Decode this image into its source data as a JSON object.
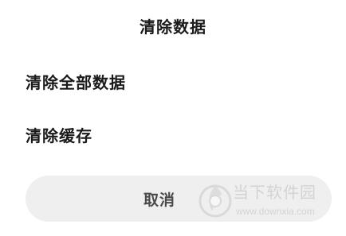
{
  "dialog": {
    "title": "清除数据",
    "options": [
      {
        "label": "清除全部数据"
      },
      {
        "label": "清除缓存"
      }
    ],
    "cancel_label": "取消"
  },
  "watermark": {
    "brand": "当下软件园",
    "url": "www.downxia.com",
    "icon": "downxia-logo-icon"
  },
  "colors": {
    "background": "#ffffff",
    "text": "#1a1a1a",
    "cancel_bg": "#efefef",
    "cancel_text": "#4a4a4a",
    "watermark": "#bdbdbd"
  }
}
